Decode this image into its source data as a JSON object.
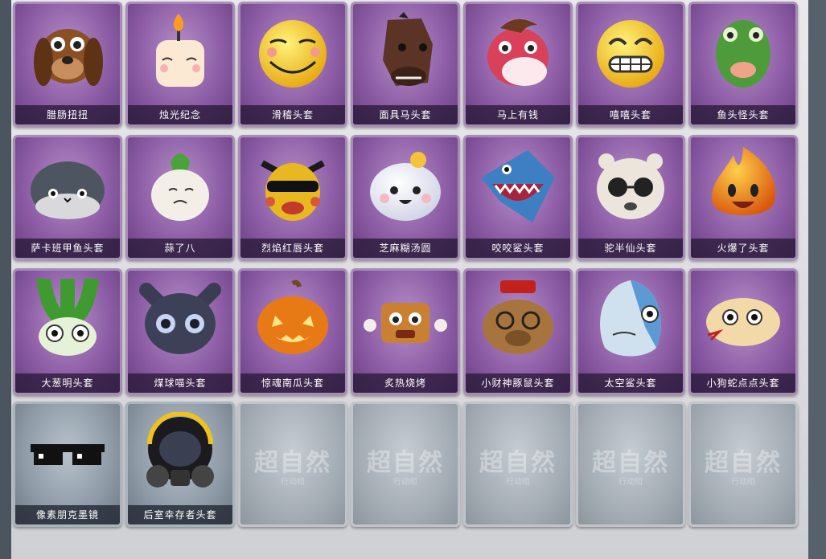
{
  "items": [
    {
      "label": "腊肠扭扭",
      "icon": "dachshund-head-icon",
      "rarity": "purple"
    },
    {
      "label": "烛光纪念",
      "icon": "candle-head-icon",
      "rarity": "purple"
    },
    {
      "label": "滑稽头套",
      "icon": "funny-face-head-icon",
      "rarity": "purple"
    },
    {
      "label": "面具马头套",
      "icon": "horse-head-icon",
      "rarity": "purple"
    },
    {
      "label": "马上有钱",
      "icon": "red-horse-head-icon",
      "rarity": "purple"
    },
    {
      "label": "嘻嘻头套",
      "icon": "grin-face-head-icon",
      "rarity": "purple"
    },
    {
      "label": "鱼头怪头套",
      "icon": "fish-head-icon",
      "rarity": "purple"
    },
    {
      "label": "萨卡班甲鱼头套",
      "icon": "sacabambaspis-head-icon",
      "rarity": "purple"
    },
    {
      "label": "蒜了八",
      "icon": "garlic-head-icon",
      "rarity": "purple"
    },
    {
      "label": "烈焰红唇头套",
      "icon": "pikachu-mask-head-icon",
      "rarity": "purple"
    },
    {
      "label": "芝麻糊汤圆",
      "icon": "rice-ball-head-icon",
      "rarity": "purple"
    },
    {
      "label": "咬咬鲨头套",
      "icon": "shark-head-icon",
      "rarity": "purple"
    },
    {
      "label": "驼半仙头套",
      "icon": "alpaca-head-icon",
      "rarity": "purple"
    },
    {
      "label": "火爆了头套",
      "icon": "fire-head-icon",
      "rarity": "purple"
    },
    {
      "label": "大葱明头套",
      "icon": "scallion-head-icon",
      "rarity": "purple"
    },
    {
      "label": "煤球喵头套",
      "icon": "black-cat-head-icon",
      "rarity": "purple"
    },
    {
      "label": "惊魂南瓜头套",
      "icon": "pumpkin-head-icon",
      "rarity": "purple"
    },
    {
      "label": "炙热烧烤",
      "icon": "bbq-head-icon",
      "rarity": "purple"
    },
    {
      "label": "小财神豚鼠头套",
      "icon": "capybara-head-icon",
      "rarity": "purple"
    },
    {
      "label": "太空鲨头套",
      "icon": "space-shark-head-icon",
      "rarity": "purple"
    },
    {
      "label": "小狗蛇点点头套",
      "icon": "snake-head-icon",
      "rarity": "purple"
    },
    {
      "label": "像素朋克墨镜",
      "icon": "pixel-sunglasses-icon",
      "rarity": "gray"
    },
    {
      "label": "后室幸存者头套",
      "icon": "gas-mask-helmet-icon",
      "rarity": "gray"
    },
    {
      "label": "",
      "icon": "empty-slot-icon",
      "rarity": "empty",
      "watermark": "超自然",
      "watermark_sub": "行动组"
    },
    {
      "label": "",
      "icon": "empty-slot-icon",
      "rarity": "empty",
      "watermark": "超自然",
      "watermark_sub": "行动组"
    },
    {
      "label": "",
      "icon": "empty-slot-icon",
      "rarity": "empty",
      "watermark": "超自然",
      "watermark_sub": "行动组"
    },
    {
      "label": "",
      "icon": "empty-slot-icon",
      "rarity": "empty",
      "watermark": "超自然",
      "watermark_sub": "行动组"
    },
    {
      "label": "",
      "icon": "empty-slot-icon",
      "rarity": "empty",
      "watermark": "超自然",
      "watermark_sub": "行动组"
    }
  ],
  "colors": {
    "purple_card": "#8e5ea6",
    "gray_card": "#8e9aa6",
    "empty_card": "#a5adb5",
    "label_bg": "#281937",
    "page_bg": "#e2e2e6"
  }
}
